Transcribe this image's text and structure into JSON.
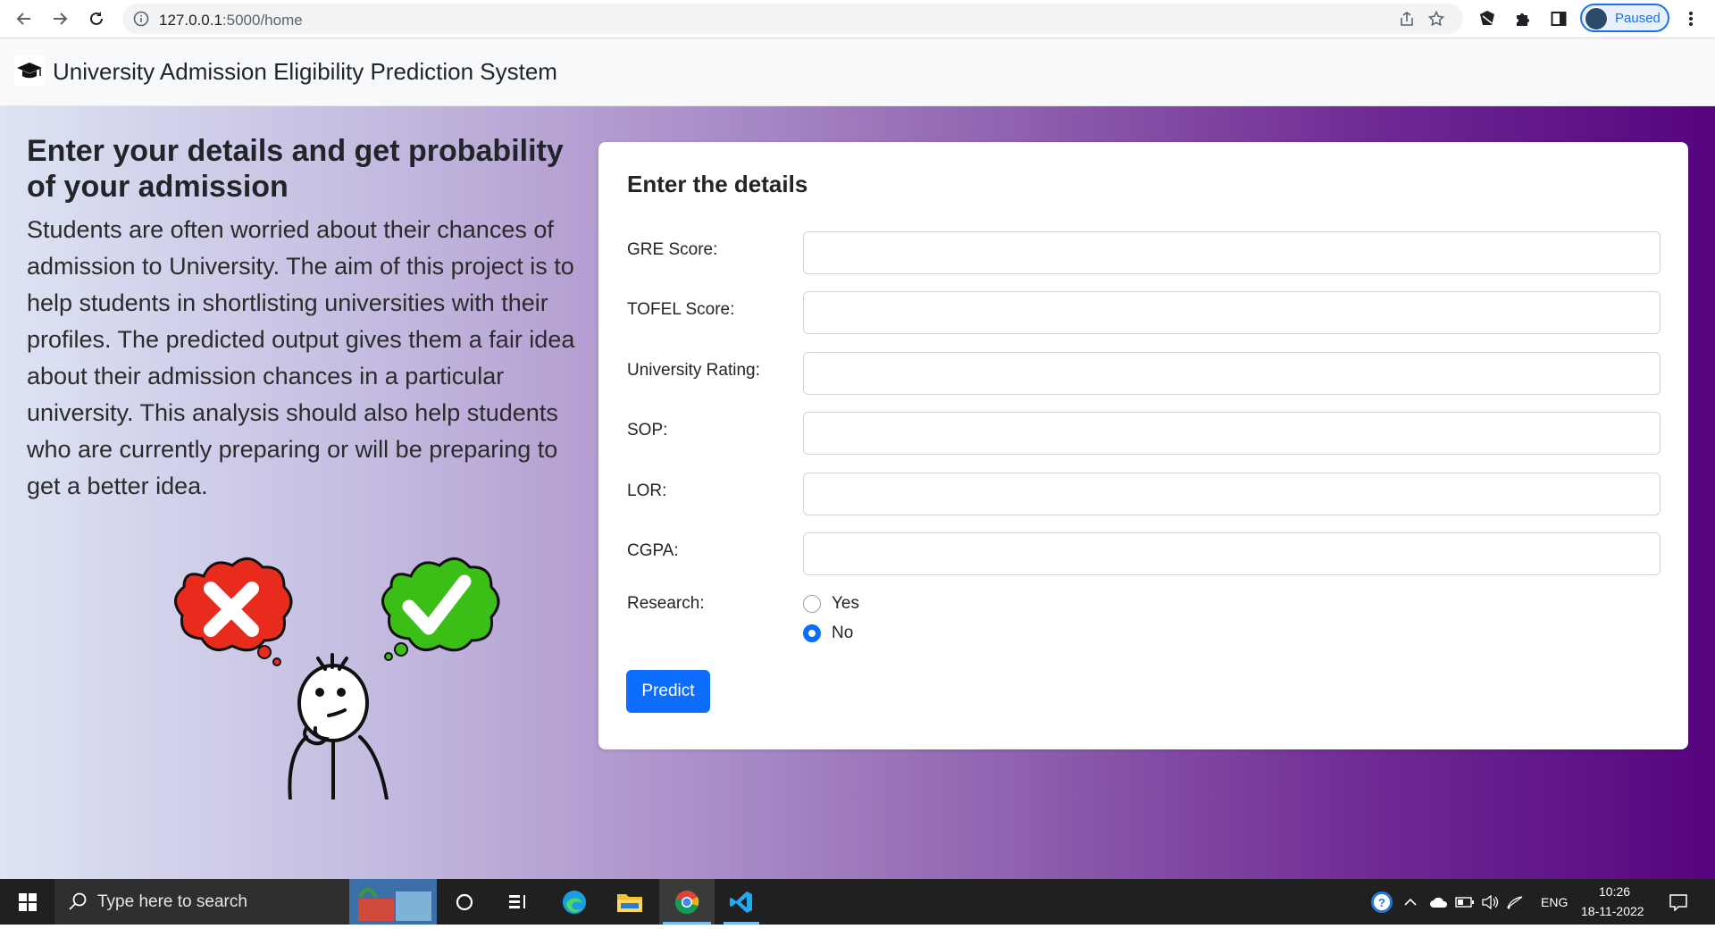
{
  "browser": {
    "url_host": "127.0.0.1",
    "url_path": ":5000/home",
    "profile_status": "Paused"
  },
  "navbar": {
    "brand": "University Admission Eligibility Prediction System"
  },
  "intro": {
    "heading": "Enter your details and get probability of your admission",
    "body": "Students are often worried about their chances of admission to University. The aim of this project is to help students in shortlisting universities with their profiles. The predicted output gives them a fair idea about their admission chances in a particular university. This analysis should also help students who are currently preparing or will be preparing to get a better idea."
  },
  "form": {
    "title": "Enter the details",
    "fields": [
      {
        "label": "GRE Score:",
        "value": ""
      },
      {
        "label": "TOFEL Score:",
        "value": ""
      },
      {
        "label": "University Rating:",
        "value": ""
      },
      {
        "label": "SOP:",
        "value": ""
      },
      {
        "label": "LOR:",
        "value": ""
      },
      {
        "label": "CGPA:",
        "value": ""
      }
    ],
    "research": {
      "label": "Research:",
      "options": [
        {
          "label": "Yes",
          "checked": false
        },
        {
          "label": "No",
          "checked": true
        }
      ]
    },
    "submit_label": "Predict"
  },
  "taskbar": {
    "search_placeholder": "Type here to search",
    "language": "ENG",
    "time": "10:26",
    "date": "18-11-2022"
  },
  "colors": {
    "primary": "#0d6efd",
    "gradient_start": "#dde4f4",
    "gradient_end": "#56047f",
    "taskbar": "#202020"
  },
  "icons": [
    "back-arrow-icon",
    "forward-arrow-icon",
    "reload-icon",
    "info-icon",
    "share-icon",
    "star-icon",
    "extension-icon",
    "puzzle-icon",
    "sidebar-icon",
    "kebab-menu-icon",
    "graduation-cap-icon",
    "windows-start-icon",
    "search-icon",
    "cortana-icon",
    "task-view-icon",
    "edge-icon",
    "file-explorer-icon",
    "chrome-icon",
    "vscode-icon",
    "help-icon",
    "chevron-up-icon",
    "onedrive-icon",
    "battery-icon",
    "volume-icon",
    "wifi-icon",
    "notification-icon"
  ]
}
